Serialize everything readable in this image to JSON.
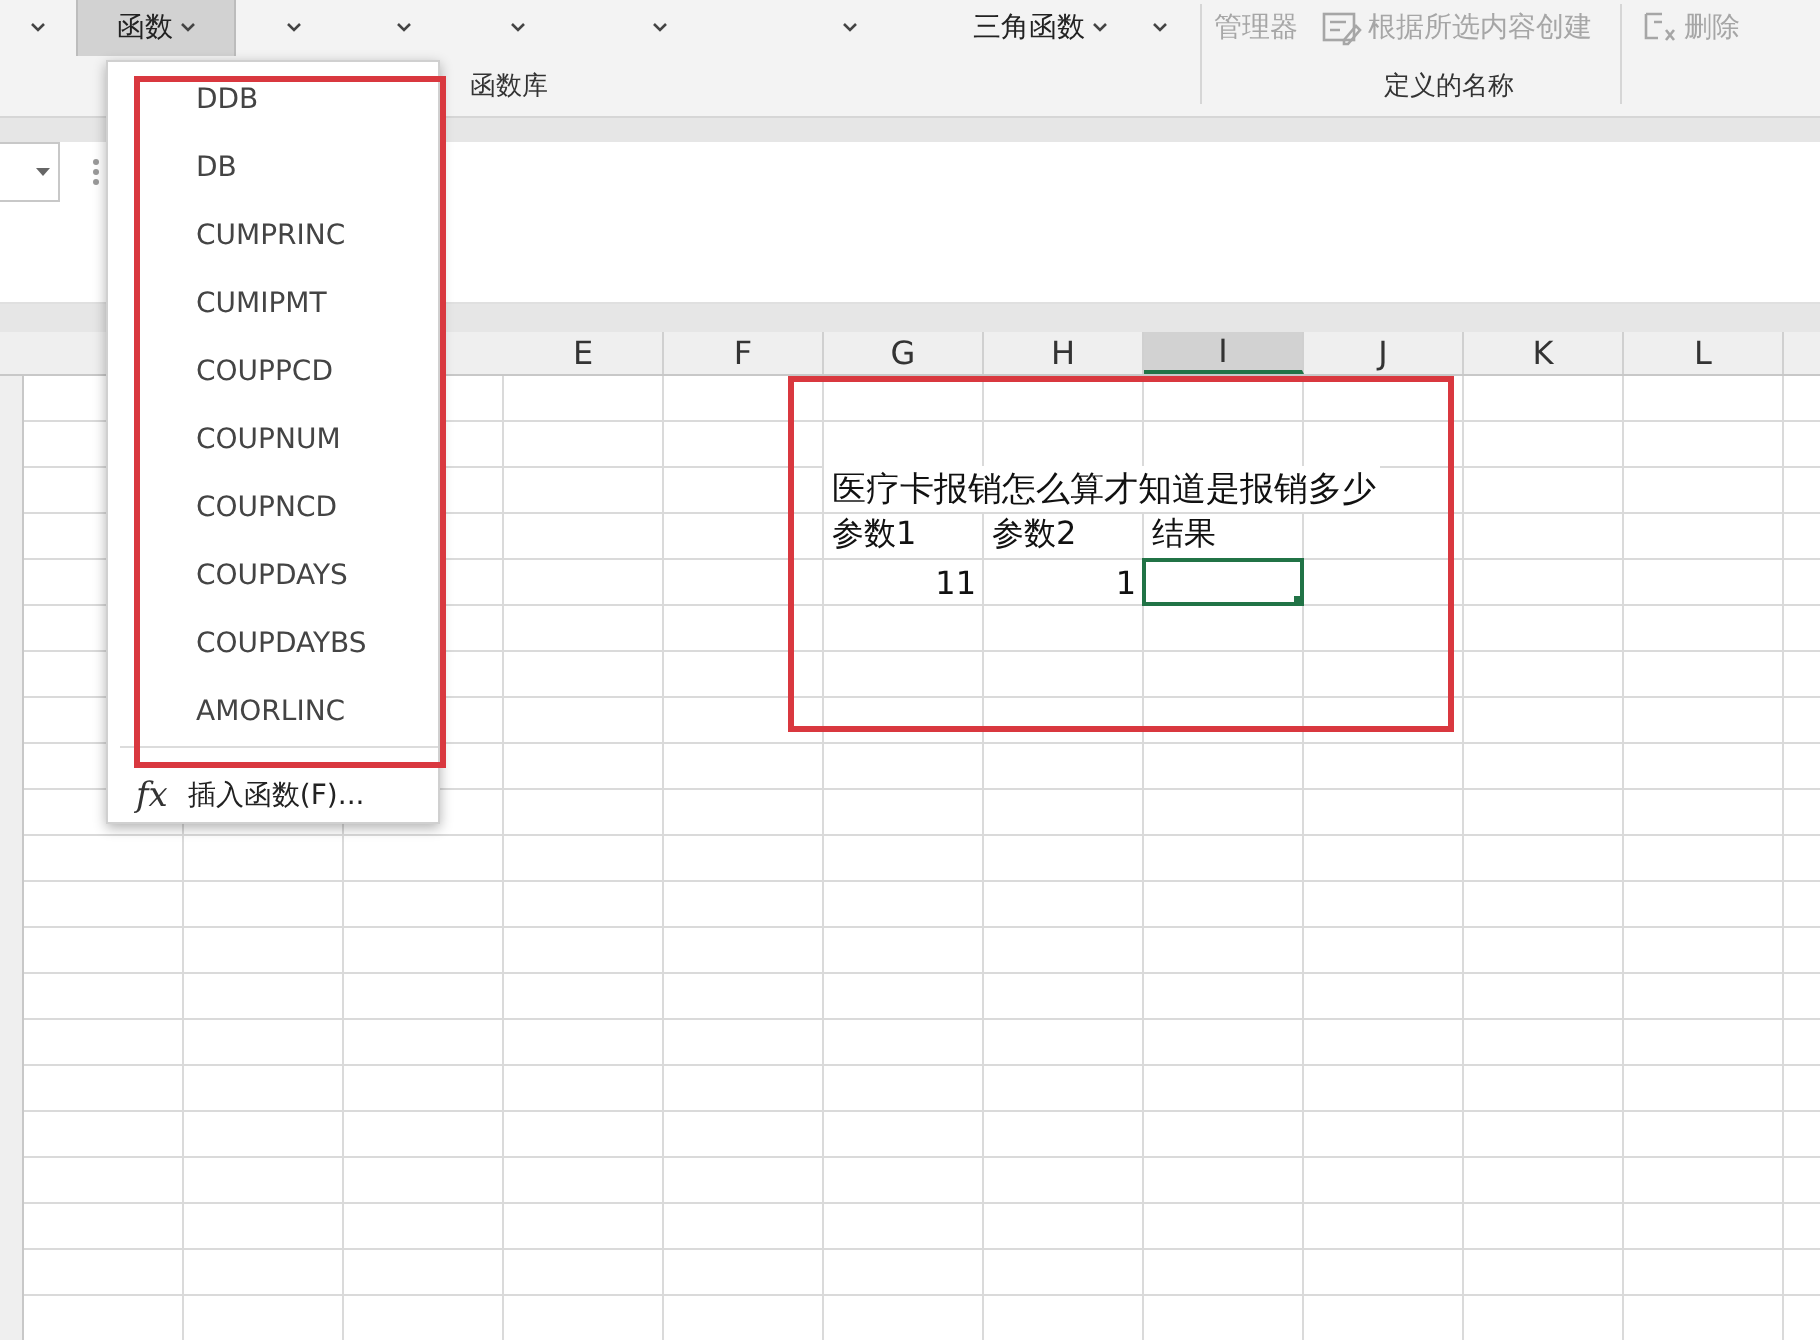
{
  "ribbon": {
    "buttons": [
      {
        "kind": "caret",
        "selected": false
      },
      {
        "label": "函数",
        "kind": "dropdown",
        "selected": true
      },
      {
        "kind": "caret",
        "selected": false
      },
      {
        "kind": "caret",
        "selected": false
      },
      {
        "kind": "caret",
        "selected": false
      },
      {
        "kind": "caret",
        "selected": false
      },
      {
        "kind": "caret",
        "selected": false
      },
      {
        "label": "三角函数",
        "kind": "dropdown",
        "selected": false
      },
      {
        "kind": "caret",
        "selected": false
      }
    ],
    "library_label": "函数库",
    "name_buttons": [
      {
        "label": "管理器",
        "kind": "text",
        "disabled": true
      },
      {
        "label": "根据所选内容创建",
        "kind": "icon",
        "disabled": true
      }
    ],
    "names_label": "定义的名称",
    "delete_button": {
      "label": "删除",
      "disabled": true
    }
  },
  "menu": {
    "items": [
      "DDB",
      "DB",
      "CUMPRINC",
      "CUMIPMT",
      "COUPPCD",
      "COUPNUM",
      "COUPNCD",
      "COUPDAYS",
      "COUPDAYBS",
      "AMORLINC"
    ],
    "footer_icon": "fx",
    "footer": "插入函数(F)..."
  },
  "sheet": {
    "columns": [
      {
        "label": "E",
        "selected": false
      },
      {
        "label": "F",
        "selected": false
      },
      {
        "label": "G",
        "selected": false
      },
      {
        "label": "H",
        "selected": false
      },
      {
        "label": "I",
        "selected": true
      },
      {
        "label": "J",
        "selected": false
      },
      {
        "label": "K",
        "selected": false
      },
      {
        "label": "L",
        "selected": false
      }
    ],
    "title": "医疗卡报销怎么算才知道是报销多少",
    "labels": [
      "参数1",
      "参数2",
      "结果"
    ],
    "values": [
      "11",
      "1"
    ],
    "result_selected": true
  }
}
